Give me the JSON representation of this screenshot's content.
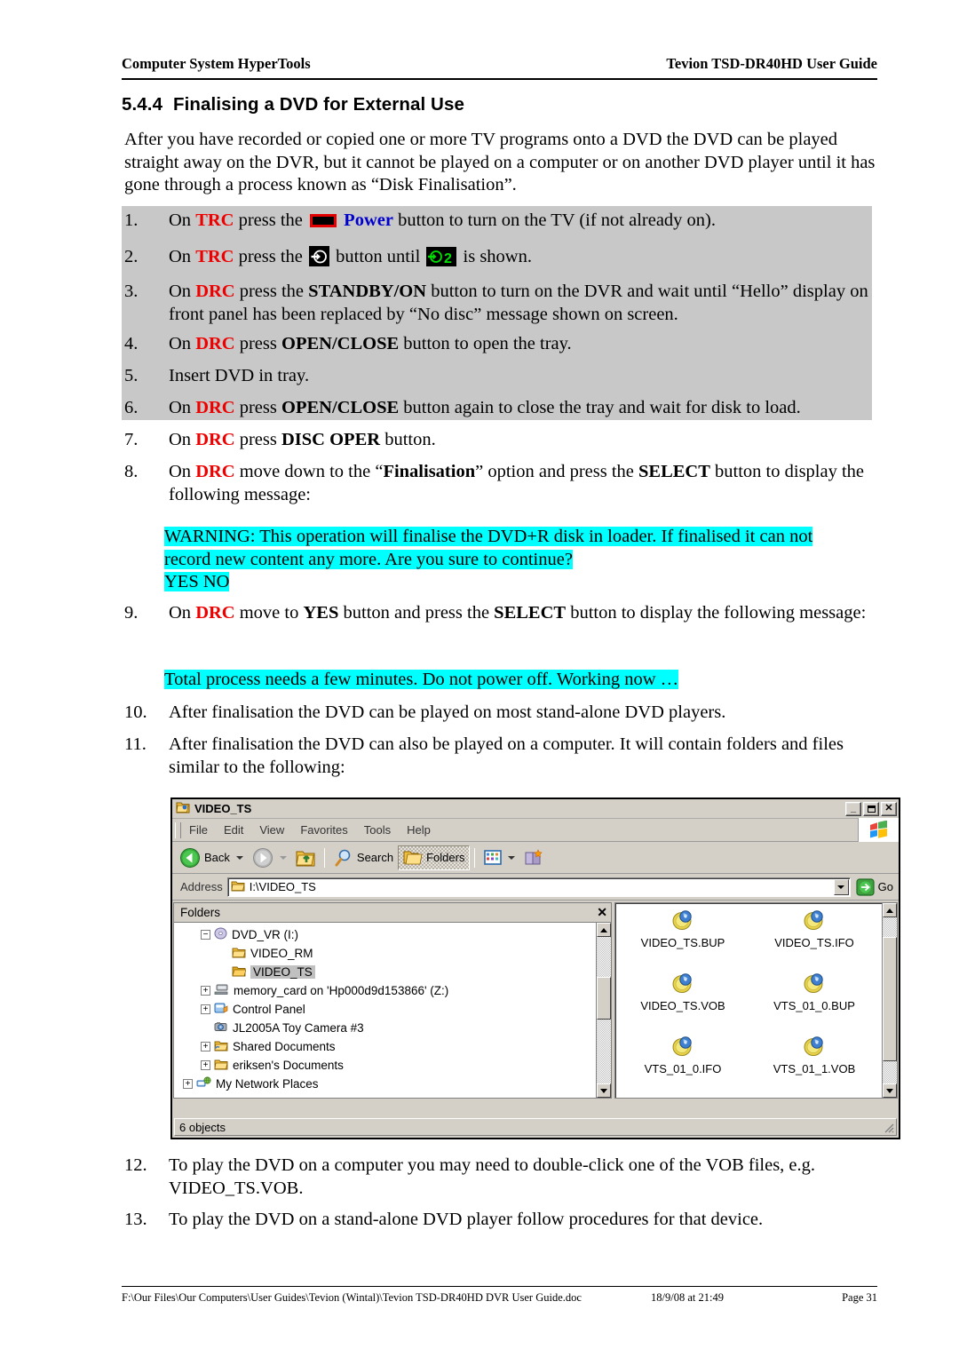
{
  "header": {
    "left": "Computer System HyperTools",
    "right": "Tevion TSD-DR40HD User Guide"
  },
  "section": {
    "number": "5.4.4",
    "title": "Finalising a DVD for External Use"
  },
  "intro": "After you have recorded or copied one or more TV programs onto a DVD the DVD can be played straight away on the DVR, but it cannot be played on a computer or on another DVD player until it has gone through a process known as “Disk Finalisation”.",
  "steps": {
    "s1": {
      "num": "1.",
      "pre": "On ",
      "remote": "TRC",
      "mid": " press the ",
      "power_label": "Power",
      "post": " button to turn on the TV (if not already on)."
    },
    "s2": {
      "num": "2.",
      "pre": "On ",
      "remote": "TRC",
      "mid": " press the ",
      "mid2": " button until ",
      "post": " is shown."
    },
    "s3": {
      "num": "3.",
      "pre": "On ",
      "remote": "DRC",
      "mid": " press the ",
      "btn": "STANDBY/ON",
      "post": " button to turn on the DVR and wait until “Hello” display on front panel has been replaced by “No disc” message shown on screen."
    },
    "s4": {
      "num": "4.",
      "pre": "On ",
      "remote": "DRC",
      "mid": " press ",
      "btn": "OPEN/CLOSE",
      "post": " button to open the tray."
    },
    "s5": {
      "num": "5.",
      "text": "Insert DVD in tray."
    },
    "s6": {
      "num": "6.",
      "pre": "On ",
      "remote": "DRC",
      "mid": " press ",
      "btn": "OPEN/CLOSE",
      "post": " button again to close the tray and wait for disk to load."
    },
    "s7": {
      "num": "7.",
      "pre": "On ",
      "remote": "DRC",
      "mid": " press ",
      "btn": "DISC OPER",
      "post": " button."
    },
    "s8": {
      "num": "8.",
      "pre": "On ",
      "remote": "DRC",
      "mid": " move down to the “",
      "btn": "Finalisation",
      "mid2": "” option and press the ",
      "btn2": "SELECT",
      "post": " button to display the following message:"
    },
    "s9": {
      "num": "9.",
      "pre": "On ",
      "remote": "DRC",
      "mid": " move to ",
      "btn": "YES",
      "mid2": " button and press the ",
      "btn2": "SELECT",
      "post": " button to display the following message:"
    },
    "s10": {
      "num": "10.",
      "text": "After finalisation the DVD can be played on most stand-alone DVD players."
    },
    "s11": {
      "num": "11.",
      "text": "After finalisation the DVD can also be played on a computer. It will contain folders and files similar to the following:"
    },
    "s12": {
      "num": "12.",
      "text": "To play the DVD on a computer you may need to double-click one of the VOB files, e.g. VIDEO_TS.VOB."
    },
    "s13": {
      "num": "13.",
      "text": "To play the DVD on a stand-alone DVD player follow procedures for that device."
    }
  },
  "messages": {
    "warning_line1": "WARNING: This operation will finalise the DVD+R disk in loader. If finalised it can not",
    "warning_line2": "record new content any more. Are you sure to continue?",
    "warning_buttons": "YES     NO",
    "working": "Total process needs a few minutes. Do not power off. Working now …"
  },
  "explorer": {
    "title": "VIDEO_TS",
    "window_buttons": {
      "minimize": "_",
      "maximize": "❑",
      "close": "✕"
    },
    "menu": [
      "File",
      "Edit",
      "View",
      "Favorites",
      "Tools",
      "Help"
    ],
    "toolbar": {
      "back": "Back",
      "search": "Search",
      "folders": "Folders"
    },
    "address": {
      "label": "Address",
      "value": "I:\\VIDEO_TS",
      "go": "Go"
    },
    "folders_pane": {
      "title": "Folders",
      "close": "✕",
      "tree": [
        {
          "indent": 1,
          "toggle": "−",
          "icon": "cd-drive-icon",
          "label": "DVD_VR (I:)",
          "selected": false
        },
        {
          "indent": 2,
          "toggle": "",
          "icon": "folder-icon",
          "label": "VIDEO_RM",
          "selected": false
        },
        {
          "indent": 2,
          "toggle": "",
          "icon": "folder-open-icon",
          "label": "VIDEO_TS",
          "selected": true
        },
        {
          "indent": 1,
          "toggle": "+",
          "icon": "network-drive-icon",
          "label": "memory_card on 'Hp000d9d153866' (Z:)",
          "selected": false
        },
        {
          "indent": 1,
          "toggle": "+",
          "icon": "control-panel-icon",
          "label": "Control Panel",
          "selected": false
        },
        {
          "indent": 1,
          "toggle": "",
          "icon": "camera-icon",
          "label": "JL2005A Toy Camera #3",
          "selected": false
        },
        {
          "indent": 1,
          "toggle": "+",
          "icon": "shared-folder-icon",
          "label": "Shared Documents",
          "selected": false
        },
        {
          "indent": 1,
          "toggle": "+",
          "icon": "folder-icon",
          "label": "eriksen's Documents",
          "selected": false
        },
        {
          "indent": 0,
          "toggle": "+",
          "icon": "network-icon",
          "label": "My Network Places",
          "selected": false
        }
      ]
    },
    "files": [
      {
        "name": "VIDEO_TS.BUP",
        "icon": "dvd-file-icon"
      },
      {
        "name": "VIDEO_TS.IFO",
        "icon": "dvd-file-icon"
      },
      {
        "name": "VIDEO_TS.VOB",
        "icon": "dvd-file-icon"
      },
      {
        "name": "VTS_01_0.BUP",
        "icon": "dvd-file-icon"
      },
      {
        "name": "VTS_01_0.IFO",
        "icon": "dvd-file-icon"
      },
      {
        "name": "VTS_01_1.VOB",
        "icon": "dvd-file-icon"
      }
    ],
    "status": "6 objects"
  },
  "footer": {
    "path": "F:\\Our Files\\Our Computers\\User Guides\\Tevion (Wintal)\\Tevion TSD-DR40HD DVR User Guide.doc",
    "date": "18/9/08 at 21:49",
    "page": "Page 31"
  },
  "colors": {
    "remote_red": "#ee0000",
    "power_blue": "#0000cc",
    "highlight_cyan": "#00ffff",
    "shaded_gray": "#c8c8c8",
    "window_chrome": "#d4d0c8"
  }
}
